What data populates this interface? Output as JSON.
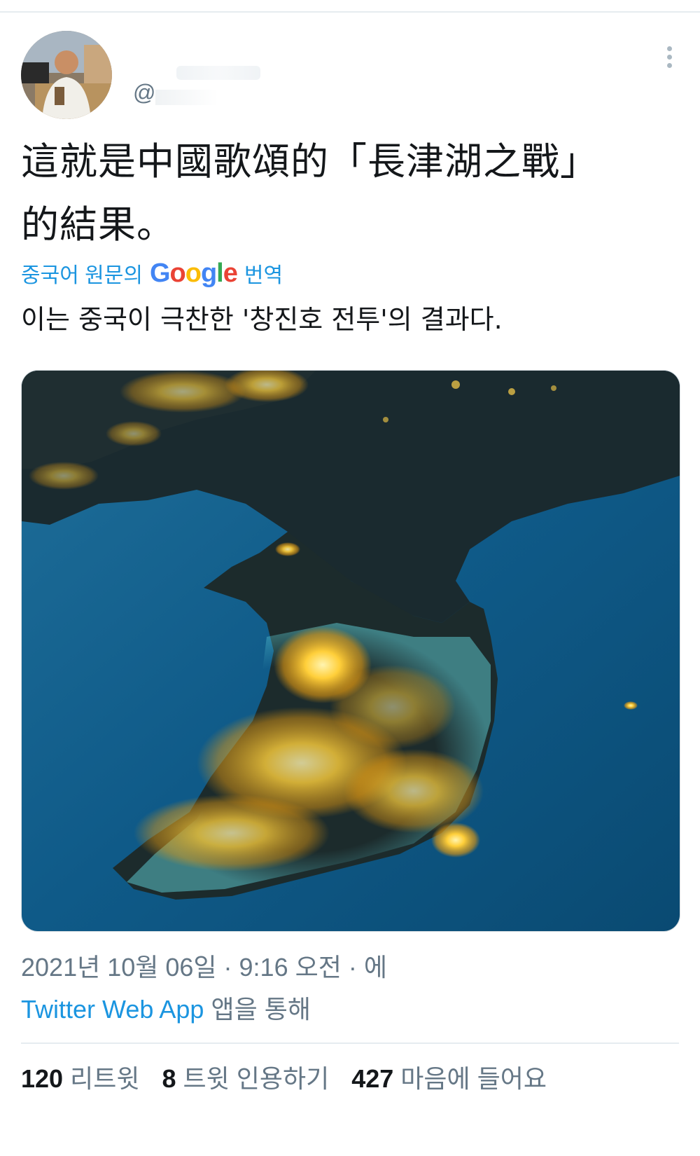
{
  "tweet": {
    "handle": "@",
    "text": "這就是中國歌頌的「長津湖之戰」\n的結果。",
    "translate": {
      "prefix": "중국어 원문의",
      "google_letters": [
        "G",
        "o",
        "o",
        "g",
        "l",
        "e"
      ],
      "suffix": "번역"
    },
    "translation": "이는 중국이 극찬한 '창진호 전투'의 결과다.",
    "timestamp": "2021년 10월 06일 · 9:16 오전 · 에",
    "source_app": "Twitter Web App",
    "source_suffix": " 앱을 통해",
    "stats": {
      "retweets": {
        "count": "120",
        "label": "리트윗"
      },
      "quotes": {
        "count": "8",
        "label": "트윗 인용하기"
      },
      "likes": {
        "count": "427",
        "label": "마음에 들어요"
      }
    }
  },
  "icons": {
    "more": "more-vertical-icon",
    "avatar": "user-avatar"
  },
  "colors": {
    "link": "#1b95e0",
    "secondary": "#657786",
    "text": "#14171a",
    "google_blue": "#4285F4",
    "google_red": "#EA4335",
    "google_yellow": "#FBBC05",
    "google_green": "#34A853"
  }
}
